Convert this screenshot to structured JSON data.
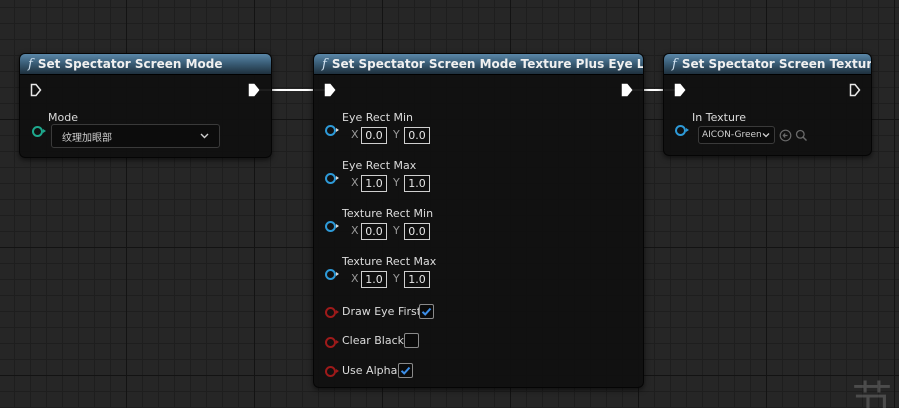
{
  "nodes": {
    "mode": {
      "title": "Set Spectator Screen Mode",
      "mode_label": "Mode",
      "mode_value": "纹理加眼部"
    },
    "layout": {
      "title": "Set Spectator Screen Mode Texture Plus Eye Layout",
      "eye_rect_min": {
        "label": "Eye Rect Min",
        "x": "0.0",
        "y": "0.0"
      },
      "eye_rect_max": {
        "label": "Eye Rect Max",
        "x": "1.0",
        "y": "1.0"
      },
      "texture_rect_min": {
        "label": "Texture Rect Min",
        "x": "0.0",
        "y": "0.0"
      },
      "texture_rect_max": {
        "label": "Texture Rect Max",
        "x": "1.0",
        "y": "1.0"
      },
      "axis_x": "X",
      "axis_y": "Y",
      "draw_eye_first": {
        "label": "Draw Eye First",
        "checked": true
      },
      "clear_black": {
        "label": "Clear Black",
        "checked": false
      },
      "use_alpha": {
        "label": "Use Alpha",
        "checked": true
      }
    },
    "texture": {
      "title": "Set Spectator Screen Texture",
      "in_texture_label": "In Texture",
      "in_texture_value": "AICON-Green"
    }
  },
  "icons": {
    "function": "function-icon",
    "exec": "exec-pin-icon",
    "dropdown": "chevron-down-icon",
    "use_asset": "arrow-left-circle-icon",
    "browse": "search-icon",
    "check": "check-icon"
  },
  "colors": {
    "header": "#3b5f79",
    "pin_vector": "#2e9ad8",
    "pin_byte": "#1ea88d",
    "pin_bool": "#9e1a1a",
    "pin_object": "#2e9ad8",
    "checkbox_check": "#3c8ee8",
    "wire": "#ffffff"
  },
  "watermark": "节"
}
